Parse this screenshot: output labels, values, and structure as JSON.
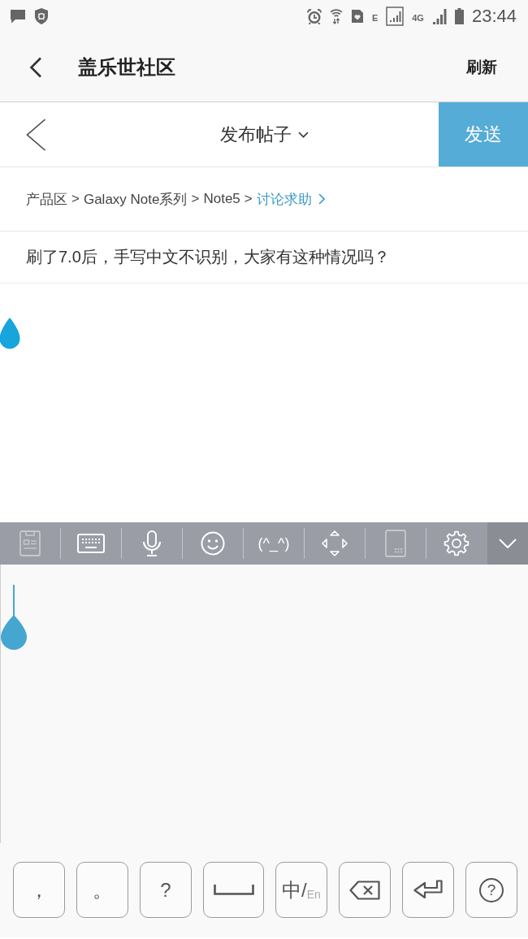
{
  "status_bar": {
    "network_labels": [
      "E",
      "4G"
    ],
    "time": "23:44"
  },
  "app_bar": {
    "title": "盖乐世社区",
    "action": "刷新"
  },
  "compose_bar": {
    "title": "发布帖子",
    "send_button": "发送"
  },
  "breadcrumb": {
    "items": [
      {
        "label": "产品区",
        "separator": ">",
        "active": false
      },
      {
        "label": "Galaxy Note系列",
        "separator": ">",
        "active": false
      },
      {
        "label": "Note5",
        "separator": ">",
        "active": false
      },
      {
        "label": "讨论求助",
        "active": true
      }
    ]
  },
  "post": {
    "title": "刷了7.0后，手写中文不识别，大家有这种情况吗？"
  },
  "keyboard": {
    "toolbar": [
      {
        "kind": "clipboard",
        "disabled": true
      },
      {
        "kind": "keyboard",
        "disabled": false
      },
      {
        "kind": "voice",
        "disabled": false
      },
      {
        "kind": "emoji",
        "disabled": false
      },
      {
        "kind": "emoticon",
        "label": "(^_^)",
        "disabled": false
      },
      {
        "kind": "cursor",
        "disabled": false
      },
      {
        "kind": "one_hand",
        "disabled": true
      },
      {
        "kind": "settings",
        "disabled": false
      }
    ],
    "keys": [
      {
        "kind": "char",
        "label": "，"
      },
      {
        "kind": "char",
        "label": "。"
      },
      {
        "kind": "char",
        "label": "?"
      },
      {
        "kind": "space"
      },
      {
        "kind": "lang",
        "label": "中/",
        "secondary": "En"
      },
      {
        "kind": "backspace"
      },
      {
        "kind": "enter"
      },
      {
        "kind": "help",
        "label": "?"
      }
    ]
  }
}
